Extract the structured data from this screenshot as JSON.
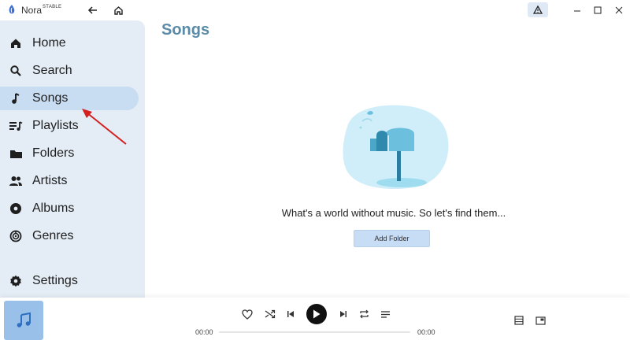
{
  "app": {
    "name": "Nora",
    "badge": "STABLE"
  },
  "colors": {
    "accent": "#5a8ba8",
    "sidebar_bg": "#e4ecf5",
    "active_item": "#c8dcf2",
    "button_bg": "#c7dcf5"
  },
  "sidebar": {
    "items": [
      {
        "label": "Home",
        "icon": "home-icon"
      },
      {
        "label": "Search",
        "icon": "search-icon"
      },
      {
        "label": "Songs",
        "icon": "music-note-icon",
        "active": true
      },
      {
        "label": "Playlists",
        "icon": "playlist-icon"
      },
      {
        "label": "Folders",
        "icon": "folder-icon"
      },
      {
        "label": "Artists",
        "icon": "people-icon"
      },
      {
        "label": "Albums",
        "icon": "album-icon"
      },
      {
        "label": "Genres",
        "icon": "genres-icon"
      }
    ],
    "settings": {
      "label": "Settings",
      "icon": "gear-icon"
    }
  },
  "main": {
    "title": "Songs",
    "empty_message": "What's a world without music. So let's find them...",
    "add_folder_label": "Add Folder"
  },
  "player": {
    "current_time": "00:00",
    "total_time": "00:00",
    "progress": 0
  }
}
